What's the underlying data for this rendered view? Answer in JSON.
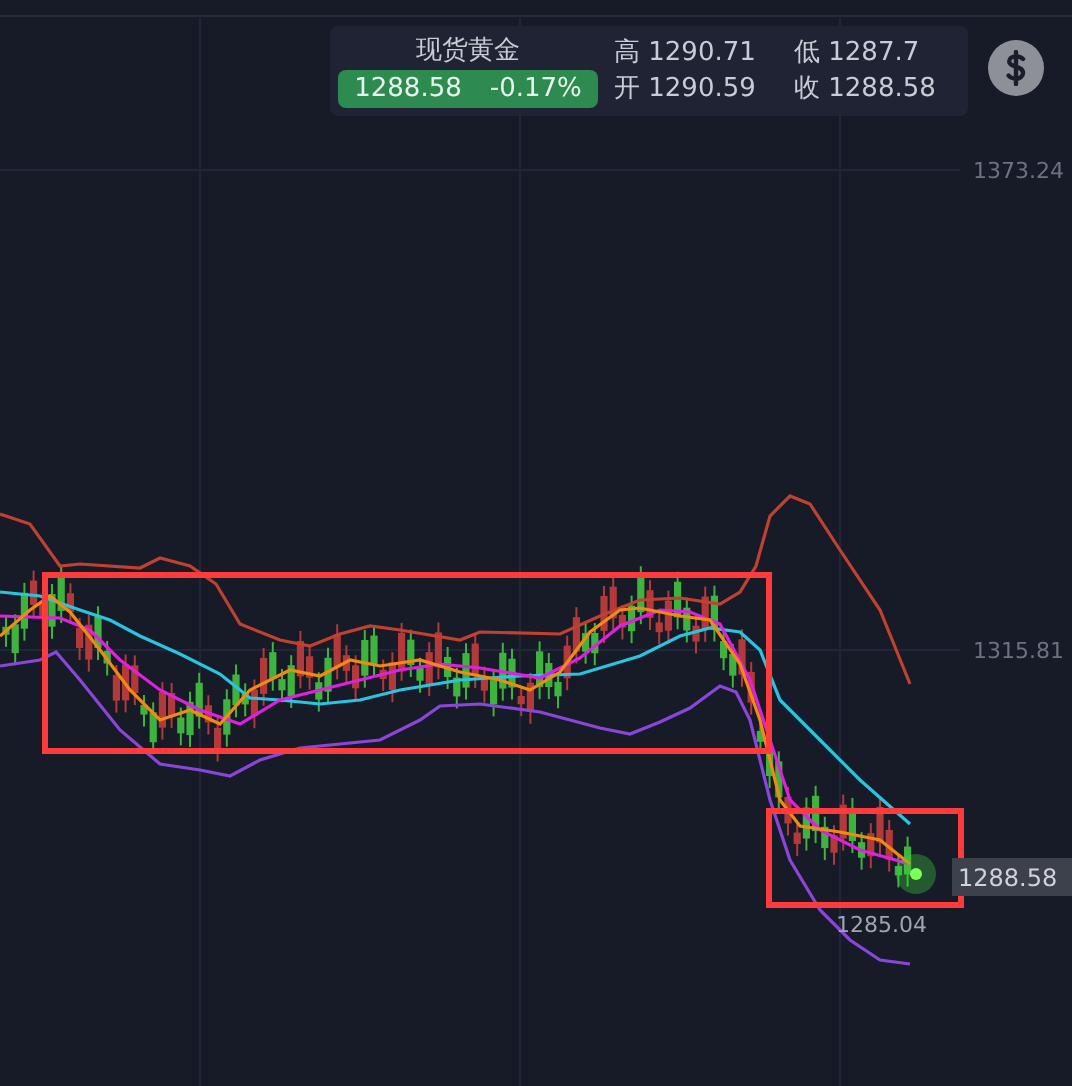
{
  "quote": {
    "title": "现货黄金",
    "price": "1288.58",
    "change": "-0.17%"
  },
  "stats": [
    {
      "label": "高",
      "value": "1290.71"
    },
    {
      "label": "低",
      "value": "1287.7"
    },
    {
      "label": "开",
      "value": "1290.59"
    },
    {
      "label": "收",
      "value": "1288.58"
    }
  ],
  "axis_labels": [
    "1373.24",
    "1315.81"
  ],
  "current_price_tag": "1288.58",
  "low_marker": "1285.04"
}
